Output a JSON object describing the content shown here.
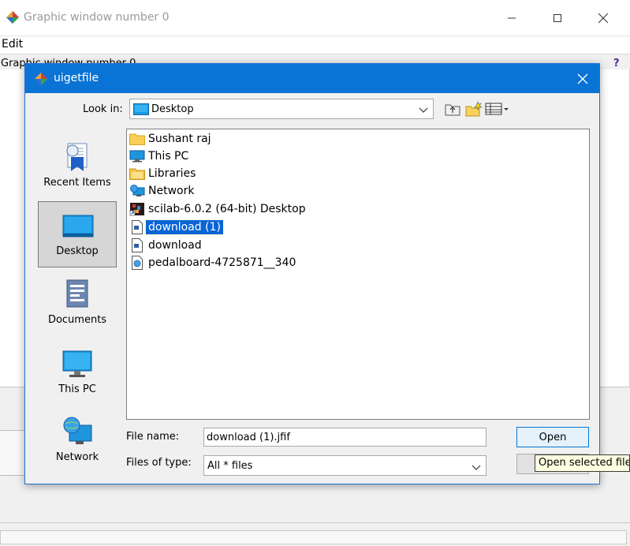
{
  "background_window": {
    "title": "Graphic window number 0",
    "menu": {
      "edit_label": "Edit"
    },
    "subtitle": "Graphic window number 0",
    "help_label": "?"
  },
  "dialog": {
    "title": "uigetfile",
    "look_in": {
      "label": "Look in:",
      "value": "Desktop"
    },
    "places": [
      {
        "label": "Recent Items",
        "icon": "recent-items-icon",
        "selected": false
      },
      {
        "label": "Desktop",
        "icon": "desktop-icon",
        "selected": true
      },
      {
        "label": "Documents",
        "icon": "documents-icon",
        "selected": false
      },
      {
        "label": "This PC",
        "icon": "this-pc-icon",
        "selected": false
      },
      {
        "label": "Network",
        "icon": "network-icon",
        "selected": false
      }
    ],
    "files": [
      {
        "name": "Sushant raj",
        "icon": "folder-icon",
        "selected": false
      },
      {
        "name": "This PC",
        "icon": "this-pc-icon",
        "selected": false
      },
      {
        "name": "Libraries",
        "icon": "libraries-icon",
        "selected": false
      },
      {
        "name": "Network",
        "icon": "network-icon",
        "selected": false
      },
      {
        "name": "scilab-6.0.2 (64-bit) Desktop",
        "icon": "shortcut-icon",
        "selected": false
      },
      {
        "name": "download (1)",
        "icon": "file-icon",
        "selected": true
      },
      {
        "name": "download",
        "icon": "file-icon",
        "selected": false
      },
      {
        "name": "pedalboard-4725871__340",
        "icon": "image-file-icon",
        "selected": false
      }
    ],
    "file_name": {
      "label": "File name:",
      "value": "download (1).jfif"
    },
    "files_of_type": {
      "label": "Files of type:",
      "value": "All * files"
    },
    "open_label": "Open",
    "tooltip": "Open selected file"
  },
  "colors": {
    "title_bar": "#0a73d6",
    "selection": "#0a64d6",
    "open_button_border": "#0078d7"
  }
}
